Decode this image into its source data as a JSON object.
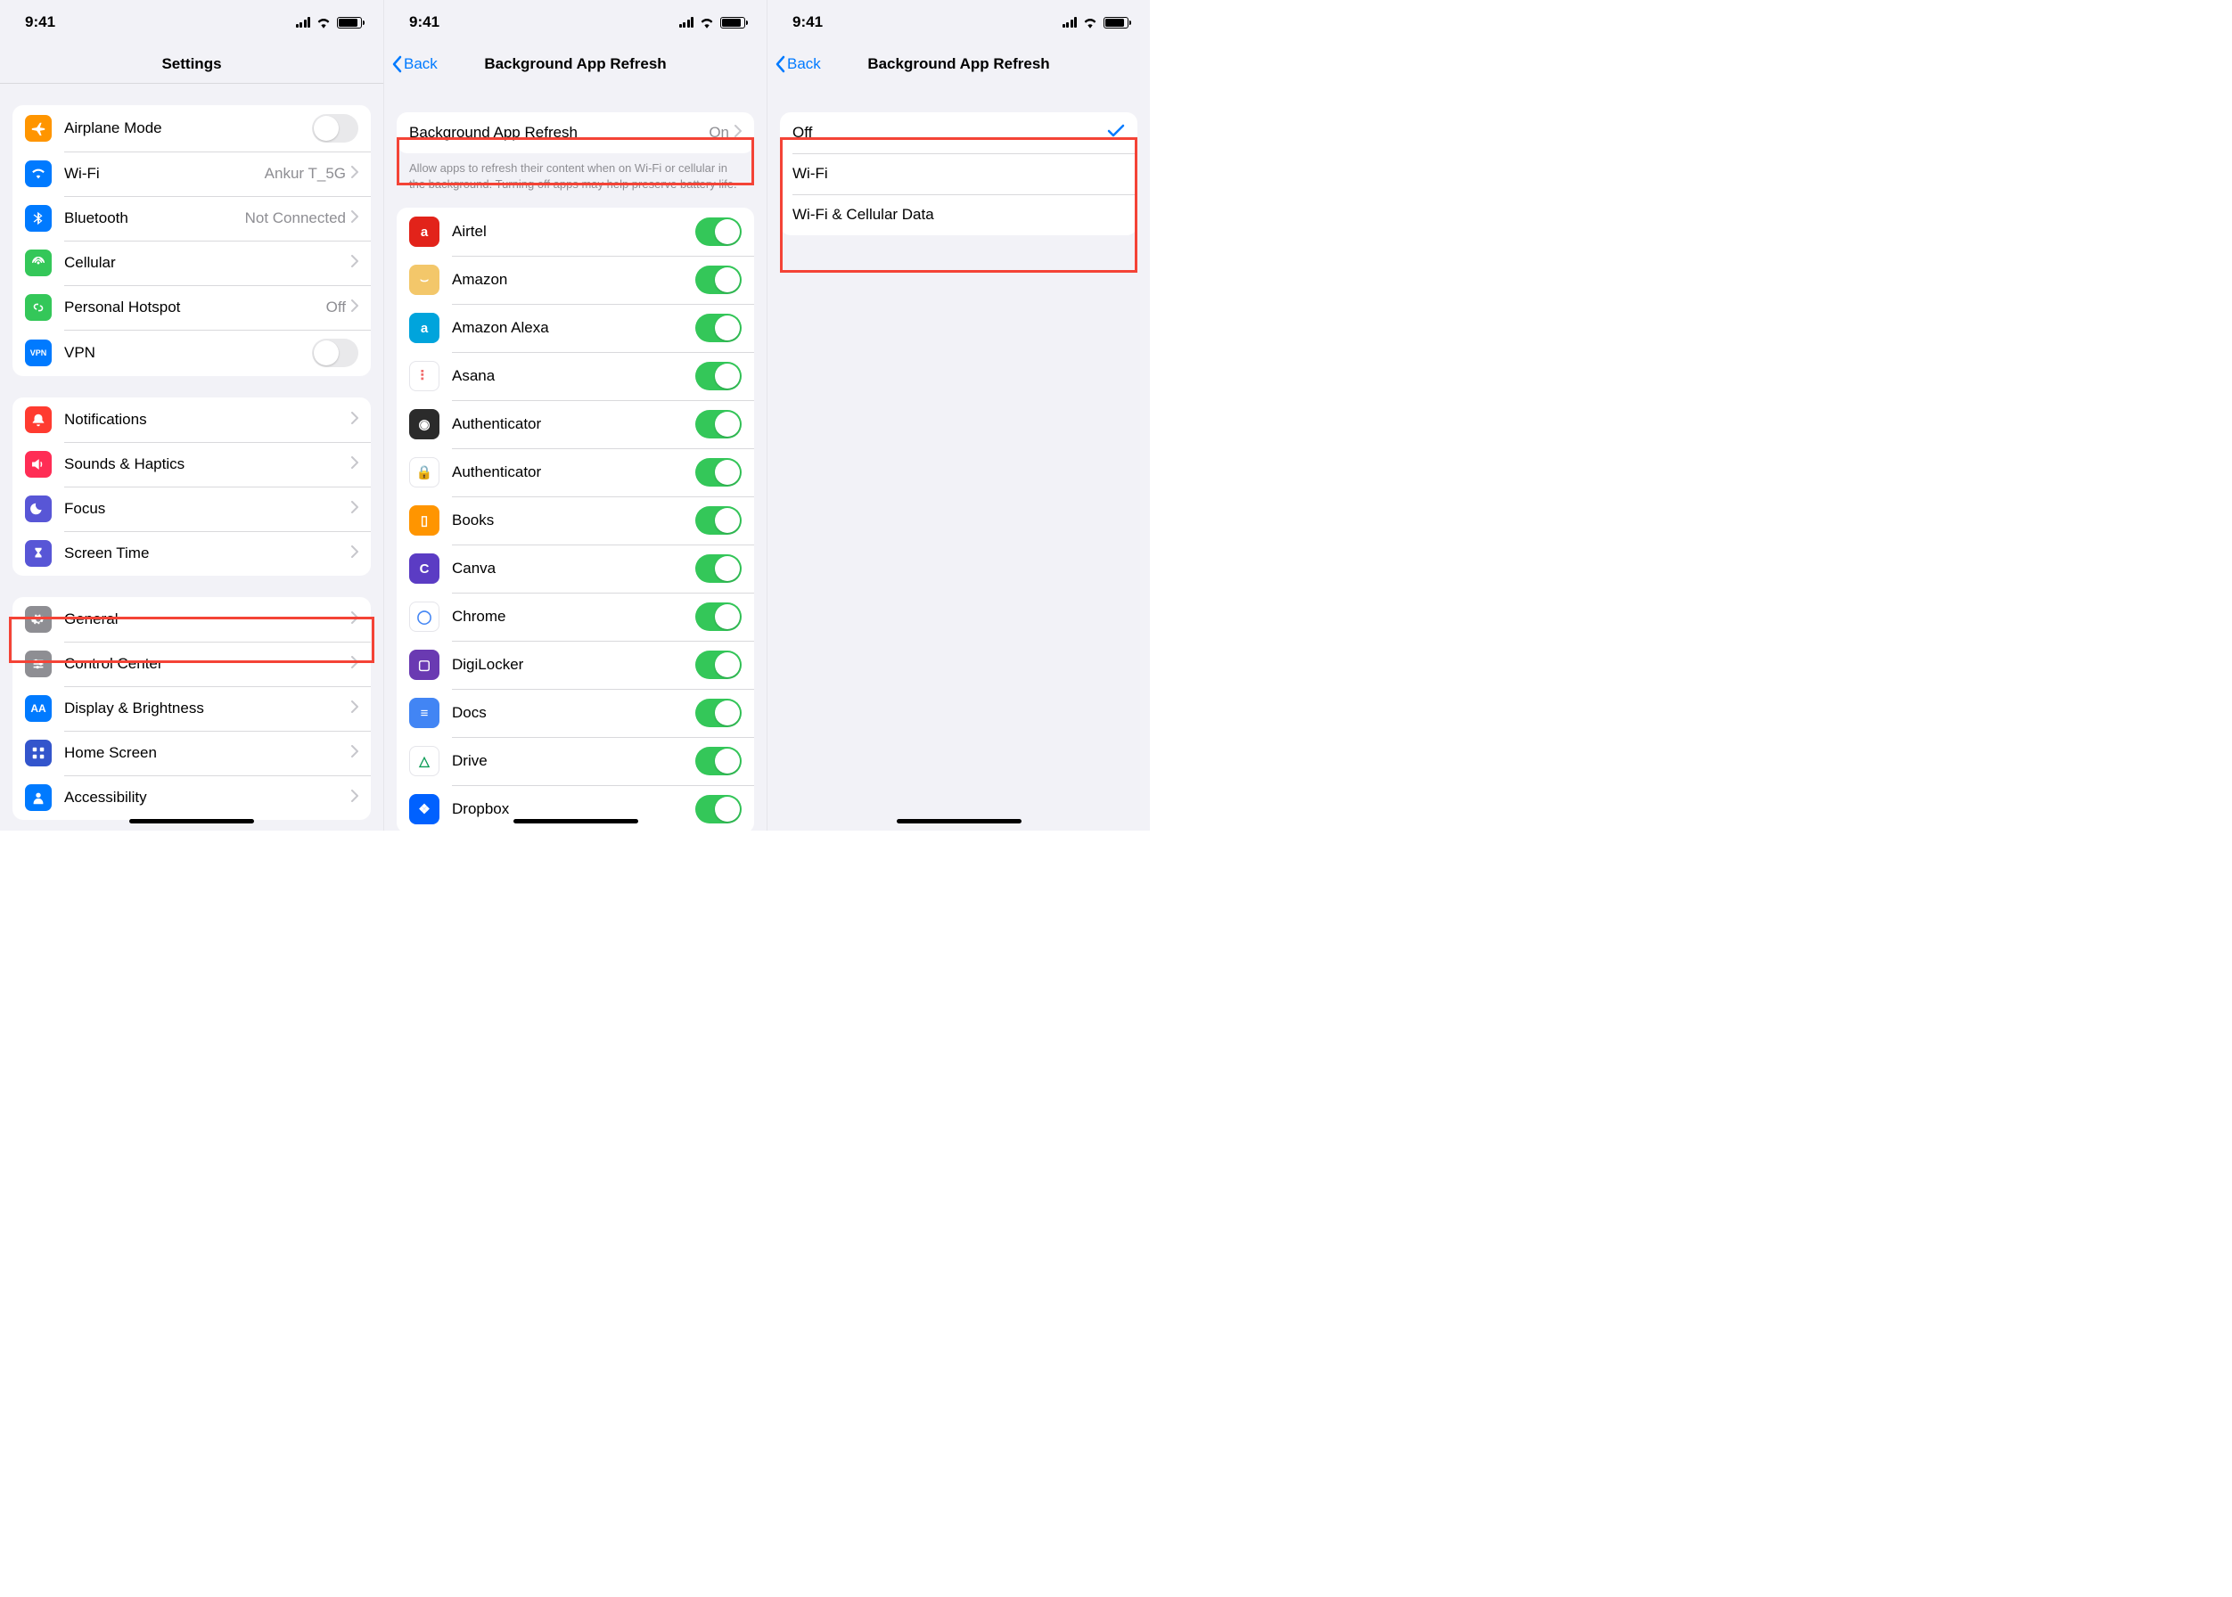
{
  "status": {
    "time": "9:41"
  },
  "screen1": {
    "title": "Settings",
    "groups": [
      {
        "cells": [
          {
            "id": "airplane",
            "label": "Airplane Mode",
            "type": "toggle",
            "on": false,
            "iconBg": "#ff9500",
            "icon": "plane"
          },
          {
            "id": "wifi",
            "label": "Wi-Fi",
            "type": "link",
            "detail": "Ankur T_5G",
            "iconBg": "#007aff",
            "icon": "wifi"
          },
          {
            "id": "bluetooth",
            "label": "Bluetooth",
            "type": "link",
            "detail": "Not Connected",
            "iconBg": "#007aff",
            "icon": "bt"
          },
          {
            "id": "cellular",
            "label": "Cellular",
            "type": "link",
            "iconBg": "#34c759",
            "icon": "antenna"
          },
          {
            "id": "hotspot",
            "label": "Personal Hotspot",
            "type": "link",
            "detail": "Off",
            "iconBg": "#34c759",
            "icon": "chain"
          },
          {
            "id": "vpn",
            "label": "VPN",
            "type": "toggle",
            "on": false,
            "iconBg": "#007aff",
            "icon": "vpn",
            "iconText": "VPN"
          }
        ]
      },
      {
        "cells": [
          {
            "id": "notifications",
            "label": "Notifications",
            "type": "link",
            "iconBg": "#ff3b30",
            "icon": "bell"
          },
          {
            "id": "sounds",
            "label": "Sounds & Haptics",
            "type": "link",
            "iconBg": "#ff2d55",
            "icon": "speaker"
          },
          {
            "id": "focus",
            "label": "Focus",
            "type": "link",
            "iconBg": "#5856d6",
            "icon": "moon"
          },
          {
            "id": "screentime",
            "label": "Screen Time",
            "type": "link",
            "iconBg": "#5856d6",
            "icon": "hourglass"
          }
        ]
      },
      {
        "cells": [
          {
            "id": "general",
            "label": "General",
            "type": "link",
            "iconBg": "#8e8e93",
            "icon": "gear",
            "highlight": true
          },
          {
            "id": "control",
            "label": "Control Center",
            "type": "link",
            "iconBg": "#8e8e93",
            "icon": "sliders"
          },
          {
            "id": "display",
            "label": "Display & Brightness",
            "type": "link",
            "iconBg": "#007aff",
            "icon": "aa",
            "iconText": "AA"
          },
          {
            "id": "home",
            "label": "Home Screen",
            "type": "link",
            "iconBg": "#3355cc",
            "icon": "grid"
          },
          {
            "id": "accessibility",
            "label": "Accessibility",
            "type": "link",
            "iconBg": "#007aff",
            "icon": "person"
          }
        ]
      }
    ]
  },
  "screen2": {
    "back": "Back",
    "title": "Background App Refresh",
    "master": {
      "label": "Background App Refresh",
      "value": "On"
    },
    "footer": "Allow apps to refresh their content when on Wi-Fi or cellular in the background. Turning off apps may help preserve battery life.",
    "apps": [
      {
        "name": "Airtel",
        "on": true,
        "bg": "#e2231a",
        "letter": "a"
      },
      {
        "name": "Amazon",
        "on": true,
        "bg": "#f3c76a",
        "letter": "⌣"
      },
      {
        "name": "Amazon Alexa",
        "on": true,
        "bg": "#00a4dc",
        "letter": "a"
      },
      {
        "name": "Asana",
        "on": true,
        "bg": "#ffffff",
        "letter": "⠇",
        "fg": "#f06a6a"
      },
      {
        "name": "Authenticator",
        "on": true,
        "bg": "#2b2b2b",
        "letter": "◉"
      },
      {
        "name": "Authenticator",
        "on": true,
        "bg": "#ffffff",
        "letter": "🔒",
        "fg": "#0078d4"
      },
      {
        "name": "Books",
        "on": true,
        "bg": "#ff9500",
        "letter": "▯"
      },
      {
        "name": "Canva",
        "on": true,
        "bg": "#5b3cc4",
        "letter": "C"
      },
      {
        "name": "Chrome",
        "on": true,
        "bg": "#ffffff",
        "letter": "◯",
        "fg": "#4285f4"
      },
      {
        "name": "DigiLocker",
        "on": true,
        "bg": "#6a3ab2",
        "letter": "▢"
      },
      {
        "name": "Docs",
        "on": true,
        "bg": "#4285f4",
        "letter": "≡"
      },
      {
        "name": "Drive",
        "on": true,
        "bg": "#ffffff",
        "letter": "△",
        "fg": "#0f9d58"
      },
      {
        "name": "Dropbox",
        "on": true,
        "bg": "#0061ff",
        "letter": "❖"
      }
    ]
  },
  "screen3": {
    "back": "Back",
    "title": "Background App Refresh",
    "options": [
      {
        "label": "Off",
        "selected": true
      },
      {
        "label": "Wi-Fi",
        "selected": false
      },
      {
        "label": "Wi-Fi & Cellular Data",
        "selected": false
      }
    ]
  }
}
